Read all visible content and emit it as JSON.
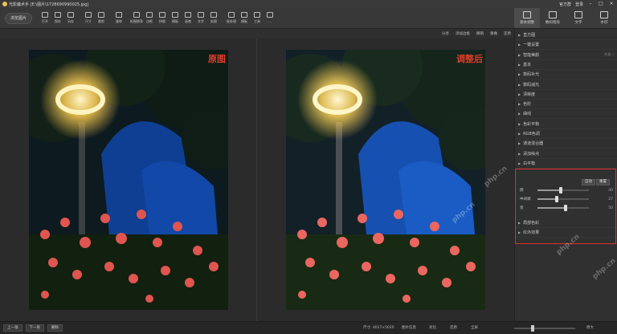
{
  "titlebar": {
    "title": "光影魔术手 [E:\\图片\\1728690990025.jpg]",
    "right_items": [
      "官方群",
      "登录"
    ]
  },
  "toolbar": {
    "browse_label": "浏览图片",
    "tools": [
      {
        "label": "打开",
        "icon": "folder-icon"
      },
      {
        "label": "保存",
        "icon": "save-icon"
      },
      {
        "label": "另存",
        "icon": "save-as-icon"
      },
      {
        "label": "尺寸",
        "icon": "resize-icon"
      },
      {
        "label": "裁剪",
        "icon": "crop-icon"
      },
      {
        "label": "旋转",
        "icon": "rotate-icon"
      },
      {
        "label": "抠图换背",
        "icon": "cutout-icon"
      },
      {
        "label": "边框",
        "icon": "frame-icon"
      },
      {
        "label": "拼图",
        "icon": "collage-icon"
      },
      {
        "label": "模板",
        "icon": "template-icon"
      },
      {
        "label": "画笔",
        "icon": "brush-icon"
      },
      {
        "label": "文字",
        "icon": "text-icon"
      },
      {
        "label": "抠图",
        "icon": "eyedrop-icon"
      },
      {
        "label": "批处理",
        "icon": "batch-icon"
      },
      {
        "label": "模板",
        "icon": "template2-icon"
      },
      {
        "label": "工具",
        "icon": "tools-icon"
      },
      {
        "label": "...",
        "icon": "more-icon"
      }
    ]
  },
  "right_tabs": [
    {
      "label": "基本调整",
      "icon": "basic-adjust-icon",
      "active": true
    },
    {
      "label": "数码暗房",
      "icon": "darkroom-icon",
      "active": false
    },
    {
      "label": "文字",
      "icon": "text-tab-icon",
      "active": false
    },
    {
      "label": "水印",
      "icon": "watermark-icon",
      "active": false
    }
  ],
  "subbar": [
    "分享",
    "添加边框",
    "撤销",
    "重做",
    "还原"
  ],
  "photos": {
    "left_label": "原图",
    "right_label": "调整后"
  },
  "panel": {
    "items": [
      {
        "name": "直方图",
        "extra": ""
      },
      {
        "name": "一键设置",
        "extra": ""
      },
      {
        "name": "智能美颜",
        "extra": "外观 ○"
      },
      {
        "name": "基本",
        "extra": ""
      },
      {
        "name": "数码补光",
        "extra": ""
      },
      {
        "name": "数码减光",
        "extra": ""
      },
      {
        "name": "清晰度",
        "extra": ""
      },
      {
        "name": "色阶",
        "extra": ""
      },
      {
        "name": "曲线",
        "extra": ""
      },
      {
        "name": "色彩平衡",
        "extra": ""
      },
      {
        "name": "RGB色调",
        "extra": ""
      },
      {
        "name": "通道混合器",
        "extra": ""
      },
      {
        "name": "添加噪点",
        "extra": ""
      },
      {
        "name": "白平衡",
        "extra": ""
      }
    ],
    "expanded": {
      "buttons": [
        "自动",
        "重置"
      ],
      "sliders": [
        {
          "label": "阴",
          "value": "40",
          "level": 0.45
        },
        {
          "label": "中间调",
          "value": "27",
          "level": 0.38
        },
        {
          "label": "亮",
          "value": "50",
          "level": 0.55
        }
      ]
    },
    "bottom_items": [
      {
        "name": "局部色彩"
      },
      {
        "name": "红外效果"
      }
    ]
  },
  "bottombar": {
    "buttons": [
      "上一张",
      "下一张",
      "删除"
    ],
    "info": "尺寸: 4017×5020",
    "actions": [
      "图片信息",
      "对比",
      "还原",
      "全屏"
    ],
    "zoom_label": "原大",
    "zoom_level": 0.3
  },
  "colors": {
    "accent_red": "#e03c2a",
    "panel_bg": "#303030",
    "toolbar_bg": "#383838"
  }
}
